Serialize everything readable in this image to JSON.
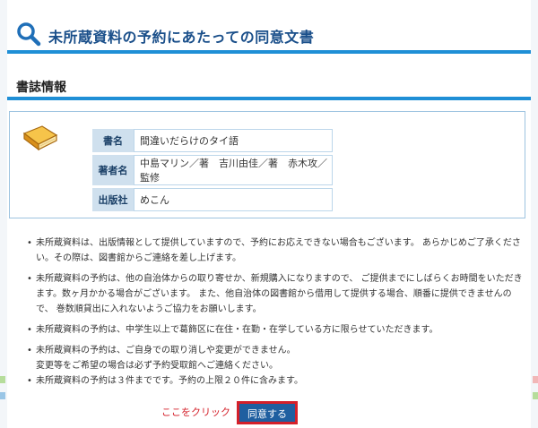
{
  "header": {
    "title": "未所蔵資料の予約にあたっての同意文書",
    "icon": "search-icon"
  },
  "section": {
    "title": "書誌情報"
  },
  "biblio": {
    "icon": "book-icon",
    "rows": [
      {
        "label": "書名",
        "value": "間違いだらけのタイ語"
      },
      {
        "label": "著者名",
        "value": "中島マリン／著　吉川由佳／著　赤木攻／監修"
      },
      {
        "label": "出版社",
        "value": "めこん"
      }
    ]
  },
  "notes": [
    {
      "lines": [
        "未所蔵資料は、出版情報として提供していますので、予約にお応えできない場合もございます。 あらかじめご了承ください。その際は、図書館からご連絡を差し上げます。"
      ]
    },
    {
      "lines": [
        "未所蔵資料の予約は、他の自治体からの取り寄せか、新規購入になりますので、 ご提供までにしばらくお時間をいただきます。数ヶ月かかる場合がございます。 また、他自治体の図書館から借用して提供する場合、順番に提供できませんので、 巻数順貸出に入れないようご協力をお願いします。"
      ]
    },
    {
      "lines": [
        "未所蔵資料の予約は、中学生以上で葛飾区に在住・在勤・在学している方に限らせていただきます。"
      ]
    },
    {
      "lines": [
        "未所蔵資料の予約は、ご自身での取り消しや変更ができません。",
        "変更等をご希望の場合は必ず予約受取館へご連絡ください。"
      ]
    },
    {
      "lines": [
        "未所蔵資料の予約は３件までです。予約の上限２０件に含みます。"
      ]
    }
  ],
  "footer": {
    "click_here": "ここをクリック",
    "agree_label": "同意する"
  },
  "colors": {
    "accent": "#1f8fd6",
    "title": "#1a4f8a",
    "label_bg": "#cfe0ee",
    "button_bg": "#1f5fa0",
    "button_border": "#d4202a"
  }
}
